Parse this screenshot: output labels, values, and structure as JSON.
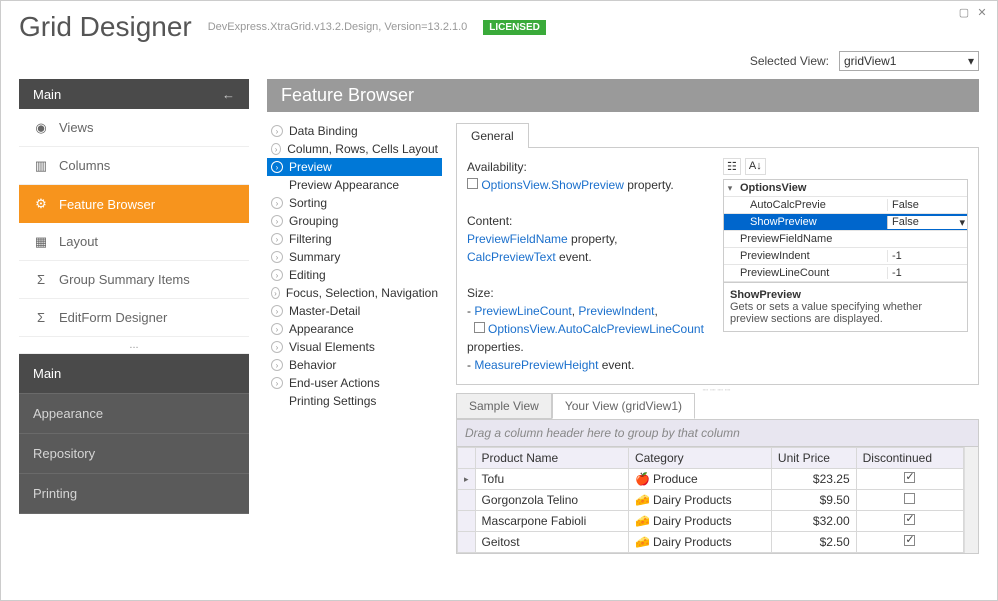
{
  "window": {
    "title": "Grid Designer"
  },
  "header": {
    "app_title": "Grid Designer",
    "version": "DevExpress.XtraGrid.v13.2.Design, Version=13.2.1.0",
    "license_badge": "LICENSED"
  },
  "selector": {
    "label": "Selected View:",
    "value": "gridView1"
  },
  "sidebar": {
    "section_title": "Main",
    "items": [
      {
        "icon": "eye-icon",
        "label": "Views"
      },
      {
        "icon": "columns-icon",
        "label": "Columns"
      },
      {
        "icon": "gear-icon",
        "label": "Feature Browser"
      },
      {
        "icon": "layout-icon",
        "label": "Layout"
      },
      {
        "icon": "sigma-icon",
        "label": "Group Summary Items"
      },
      {
        "icon": "sigma-icon",
        "label": "EditForm Designer"
      }
    ],
    "collapse_label": "...",
    "categories": [
      "Main",
      "Appearance",
      "Repository",
      "Printing"
    ]
  },
  "main": {
    "title": "Feature Browser",
    "tree": [
      "Data Binding",
      "Column, Rows, Cells Layout",
      "Preview",
      "Preview Appearance",
      "Sorting",
      "Grouping",
      "Filtering",
      "Summary",
      "Editing",
      "Focus, Selection, Navigation",
      "Master-Detail",
      "Appearance",
      "Visual Elements",
      "Behavior",
      "End-user Actions",
      "Printing Settings"
    ],
    "tab_general": "General",
    "desc": {
      "availability_label": "Availability:",
      "avail_link": "OptionsView.ShowPreview",
      "avail_suffix": " property.",
      "content_label": "Content:",
      "content_link1": "PreviewFieldName",
      "content_mid1": " property, ",
      "content_link2": "CalcPreviewText",
      "content_suffix": " event.",
      "size_label": "Size:",
      "size_link1": "PreviewLineCount",
      "size_sep1": ", ",
      "size_link2": "PreviewIndent",
      "size_sep2": ", ",
      "size_link3": "OptionsView.AutoCalcPreviewLineCount",
      "size_suffix": " properties.",
      "size_link4": "MeasurePreviewHeight",
      "size_suffix2": " event."
    },
    "props": {
      "group": "OptionsView",
      "rows": [
        {
          "name": "AutoCalcPreviewLineCount",
          "short": "AutoCalcPrevie",
          "value": "False"
        },
        {
          "name": "ShowPreview",
          "short": "ShowPreview",
          "value": "False",
          "selected": true,
          "dropdown": true
        },
        {
          "name": "PreviewFieldName",
          "short": "PreviewFieldName",
          "value": ""
        },
        {
          "name": "PreviewIndent",
          "short": "PreviewIndent",
          "value": "-1"
        },
        {
          "name": "PreviewLineCount",
          "short": "PreviewLineCount",
          "value": "-1"
        }
      ],
      "desc_title": "ShowPreview",
      "desc_text": "Gets or sets a value specifying whether preview sections are displayed."
    },
    "grid_tabs": {
      "sample": "Sample View",
      "your": "Your View (gridView1)"
    },
    "grid": {
      "group_panel": "Drag a column header here to group by that column",
      "columns": [
        "Product Name",
        "Category",
        "Unit Price",
        "Discontinued"
      ],
      "rows": [
        {
          "name": "Tofu",
          "cat": "Produce",
          "icon": "apple",
          "price": "$23.25",
          "disc": true,
          "current": true
        },
        {
          "name": "Gorgonzola Telino",
          "cat": "Dairy Products",
          "icon": "cheese",
          "price": "$9.50",
          "disc": false
        },
        {
          "name": "Mascarpone Fabioli",
          "cat": "Dairy Products",
          "icon": "cheese",
          "price": "$32.00",
          "disc": true
        },
        {
          "name": "Geitost",
          "cat": "Dairy Products",
          "icon": "cheese",
          "price": "$2.50",
          "disc": true
        }
      ]
    }
  }
}
